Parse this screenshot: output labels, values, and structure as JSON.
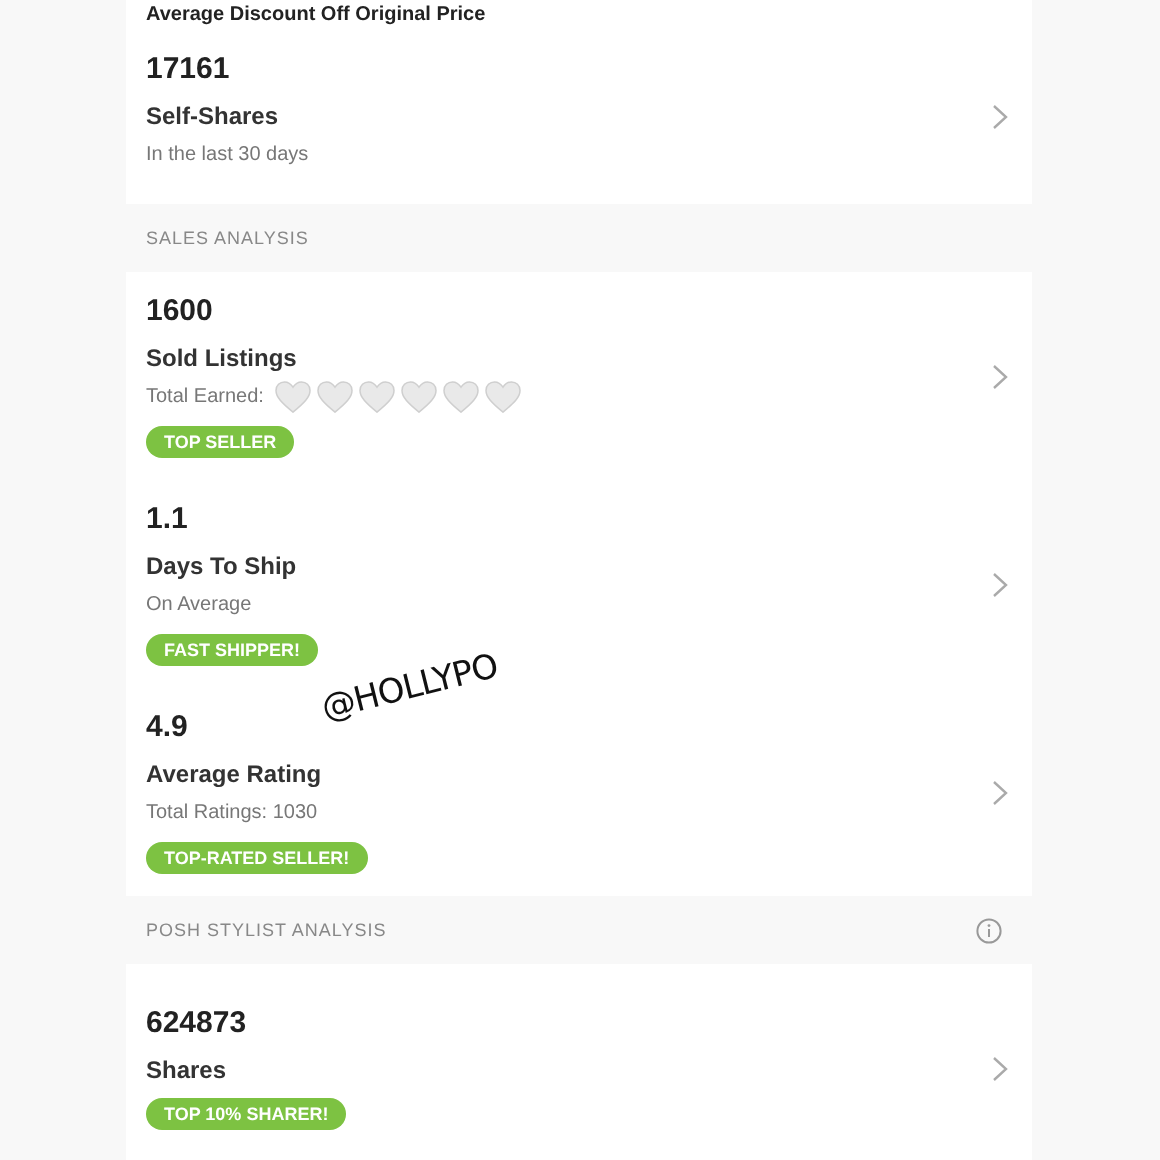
{
  "top_label": "Average Discount Off Original Price",
  "sections": [
    {
      "items": [
        {
          "value": "17161",
          "title": "Self-Shares",
          "subtitle": "In the last 30 days"
        }
      ]
    },
    {
      "heading": "SALES ANALYSIS",
      "items": [
        {
          "value": "1600",
          "title": "Sold Listings",
          "subtitle": "Total Earned:",
          "stickers": [
            {
              "kind": "heart"
            },
            {
              "kind": "heart"
            },
            {
              "kind": "heart"
            },
            {
              "kind": "heart"
            },
            {
              "kind": "heart"
            },
            {
              "kind": "heart"
            }
          ],
          "badge": "TOP SELLER"
        },
        {
          "value": "1.1",
          "title": "Days To Ship",
          "subtitle": "On Average",
          "badge": "FAST SHIPPER!"
        },
        {
          "value": "4.9",
          "title": "Average Rating",
          "subtitle": "Total Ratings: 1030",
          "badge": "TOP-RATED SELLER!"
        }
      ]
    },
    {
      "heading": "POSH STYLIST ANALYSIS",
      "info": true,
      "items": [
        {
          "value": "624873",
          "title": "Shares",
          "badge": "TOP 10% SHARER!"
        }
      ]
    }
  ],
  "overlay": "@HOLLYPO"
}
